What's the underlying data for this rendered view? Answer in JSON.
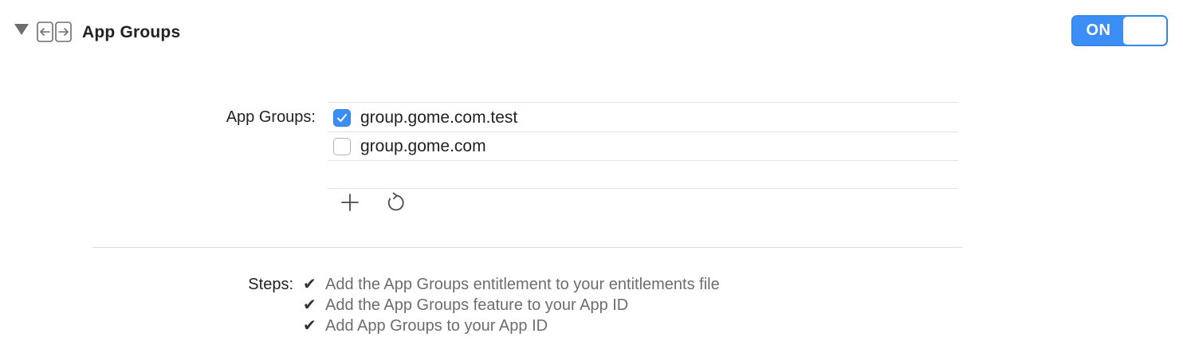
{
  "header": {
    "title": "App Groups",
    "icon": "app-groups-capability-icon",
    "expanded": true
  },
  "toggle": {
    "label": "ON",
    "state": true,
    "accent_color": "#3a8ef6"
  },
  "app_groups": {
    "label": "App Groups:",
    "items": [
      {
        "name": "group.gome.com.test",
        "checked": true
      },
      {
        "name": "group.gome.com",
        "checked": false
      }
    ],
    "actions": [
      {
        "icon": "plus-icon"
      },
      {
        "icon": "refresh-icon"
      }
    ]
  },
  "steps": {
    "label": "Steps:",
    "check_mark": "✔",
    "items": [
      "Add the App Groups entitlement to your entitlements file",
      "Add the App Groups feature to your App ID",
      "Add App Groups to your App ID"
    ]
  }
}
